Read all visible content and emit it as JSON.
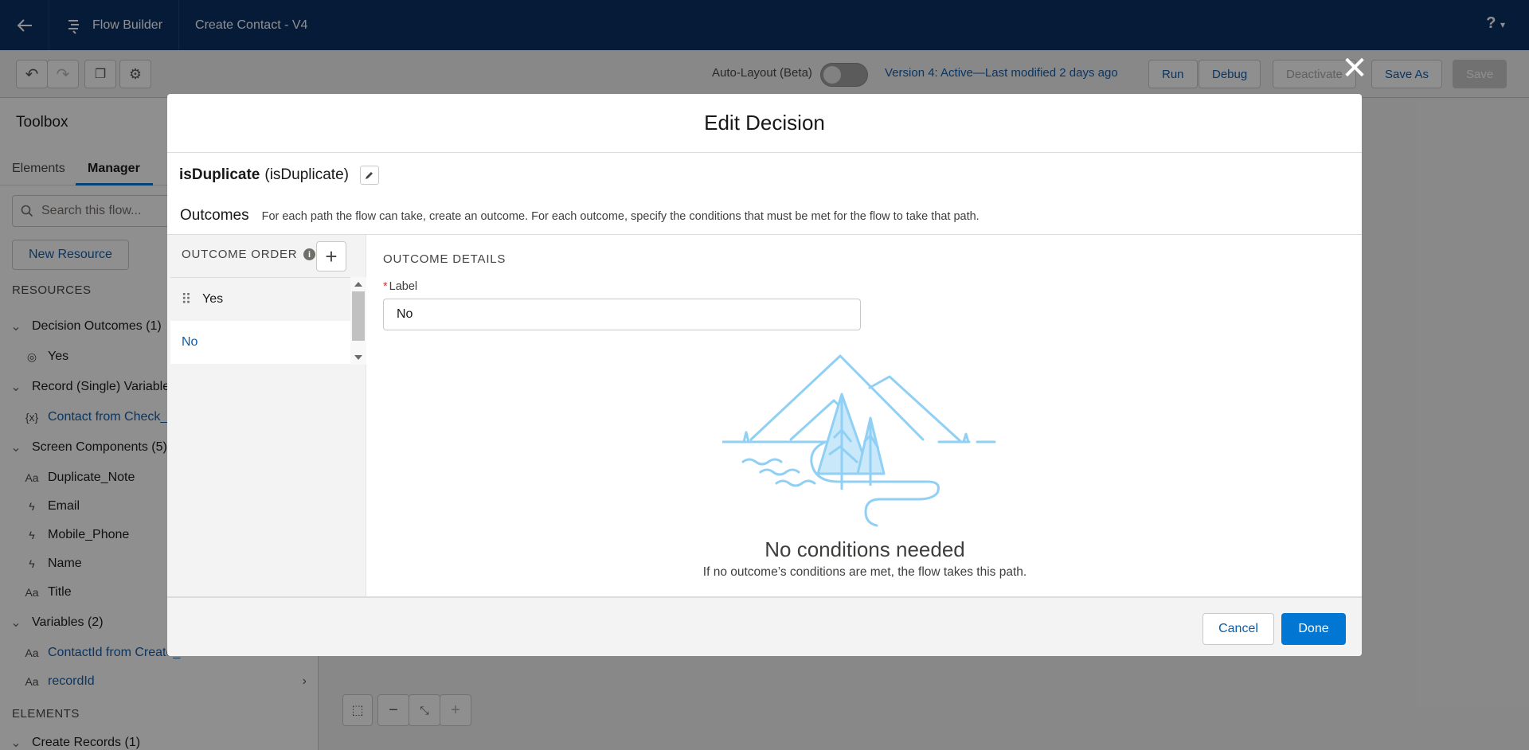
{
  "header": {
    "app_name": "Flow Builder",
    "flow_name": "Create Contact - V4",
    "help_label": "?"
  },
  "toolbar": {
    "autolayout_label": "Auto-Layout (Beta)",
    "version_label": "Version 4: Active—Last modified 2 days ago",
    "run_label": "Run",
    "debug_label": "Debug",
    "deactivate_label": "Deactivate",
    "save_as_label": "Save As",
    "save_label": "Save"
  },
  "toolbox": {
    "title": "Toolbox",
    "tabs": [
      "Elements",
      "Manager"
    ],
    "active_tab": "Manager",
    "search_placeholder": "Search this flow...",
    "new_resource_label": "New Resource",
    "resources_heading": "RESOURCES",
    "elements_heading": "ELEMENTS",
    "groups": [
      {
        "label": "Decision Outcomes (1)",
        "items": [
          {
            "label": "Yes",
            "icon": "decision-outcome-icon"
          }
        ]
      },
      {
        "label": "Record (Single) Variables",
        "items": [
          {
            "label": "Contact from Check_",
            "icon": "record-variable-icon"
          }
        ]
      },
      {
        "label": "Screen Components (5)",
        "items": [
          {
            "label": "Duplicate_Note",
            "icon": "text-icon"
          },
          {
            "label": "Email",
            "icon": "lightning-icon"
          },
          {
            "label": "Mobile_Phone",
            "icon": "lightning-icon"
          },
          {
            "label": "Name",
            "icon": "lightning-icon"
          },
          {
            "label": "Title",
            "icon": "text-icon"
          }
        ]
      },
      {
        "label": "Variables (2)",
        "items": [
          {
            "label": "ContactId from Create_Record",
            "icon": "text-icon"
          },
          {
            "label": "recordId",
            "icon": "text-icon"
          }
        ]
      }
    ],
    "elements_first_item": "Create Records (1)"
  },
  "modal": {
    "title": "Edit Decision",
    "element_label": "isDuplicate",
    "element_api_name": "(isDuplicate)",
    "outcomes_title": "Outcomes",
    "outcomes_description": "For each path the flow can take, create an outcome. For each outcome, specify the conditions that must be met for the flow to take that path.",
    "outcome_order_heading": "OUTCOME ORDER",
    "outcomes": [
      "Yes",
      "No"
    ],
    "selected_outcome": "No",
    "details_heading": "OUTCOME DETAILS",
    "label_field_label": "Label",
    "label_field_value": "No",
    "no_conditions_title": "No conditions needed",
    "no_conditions_description": "If no outcome’s conditions are met, the flow takes this path.",
    "cancel_label": "Cancel",
    "done_label": "Done"
  },
  "colors": {
    "header_bg": "#032d60",
    "brand_blue": "#0176d3",
    "link_blue": "#0b5cab",
    "illustration_blue": "#8fd0f4"
  }
}
